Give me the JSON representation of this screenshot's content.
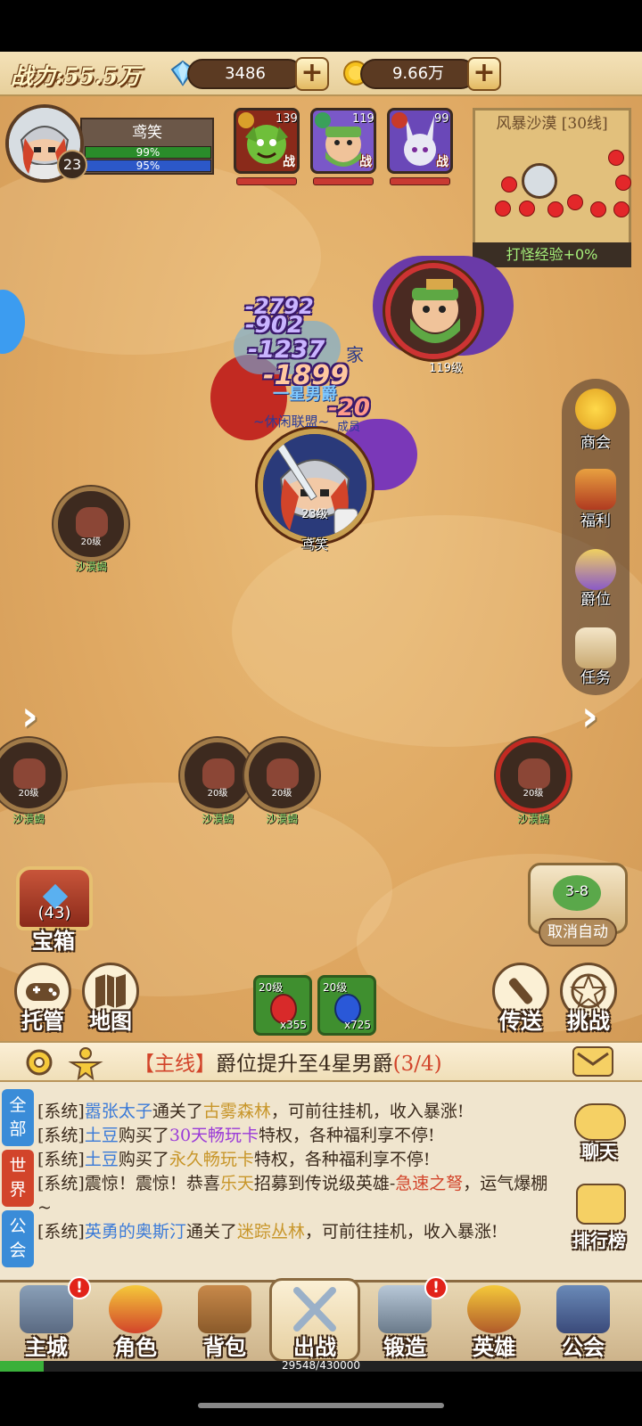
{
  "header": {
    "power_label": "战力:55.5万",
    "diamonds": "3486",
    "gold": "9.66万",
    "plus_symbol": "+"
  },
  "player": {
    "name": "鸢笑",
    "level": "23",
    "hp": "99%",
    "mp": "95%",
    "hp_fill": 0.99,
    "mp_fill": 0.95
  },
  "heroes": [
    {
      "level": "139",
      "tag": "战"
    },
    {
      "level": "119",
      "tag": "战"
    },
    {
      "level": "99",
      "tag": "战"
    }
  ],
  "minimap": {
    "title": "风暴沙漠 [30线]",
    "footer": "打怪经验+0%"
  },
  "battle": {
    "damage_numbers": [
      "-2792",
      "-902",
      "-1237",
      "-1899",
      "-20"
    ],
    "ally_level": "119级",
    "player_level": "23级",
    "player_name": "鸢笑",
    "title_text": "一星男爵",
    "guild_text": "~休闲联盟~",
    "partial_text_1": "家",
    "partial_text_2": "成员"
  },
  "monsters": {
    "level": "20级",
    "name": "沙漠蝎"
  },
  "right_menu": [
    "商会",
    "福利",
    "爵位",
    "任务"
  ],
  "treasure": {
    "count": "(43)",
    "label": "宝箱"
  },
  "auto_battle": {
    "stage": "3-8",
    "label": "取消自动"
  },
  "bottom_buttons": {
    "auto": "托管",
    "map": "地图",
    "teleport": "传送",
    "challenge": "挑战"
  },
  "potions": [
    {
      "level": "20级",
      "count": "x355"
    },
    {
      "level": "20级",
      "count": "x725"
    }
  ],
  "quest": {
    "tag": "【主线】",
    "text": "爵位提升至4星男爵",
    "progress": "(3/4)"
  },
  "chat": {
    "tabs": [
      "全部",
      "世界",
      "公会"
    ],
    "side_buttons": [
      "聊天",
      "排行榜"
    ],
    "lines": [
      {
        "prefix": "[系统]",
        "who": "嚣张太子",
        "mid": "通关了",
        "target": "古雾森林",
        "rest": "，可前往挂机，收入暴涨!"
      },
      {
        "prefix": "[系统]",
        "who": "土豆",
        "mid": "购买了",
        "target": "30天畅玩卡",
        "rest": "特权，各种福利享不停!"
      },
      {
        "prefix": "[系统]",
        "who": "土豆",
        "mid": "购买了",
        "target": "永久畅玩卡",
        "rest": "特权，各种福利享不停!"
      },
      {
        "prefix": "[系统]",
        "who": "震惊！震惊！恭喜",
        "mid": "乐天",
        "target": "招募到传说级英雄-",
        "rest": "急速之弩",
        "tail": "，运气爆棚~"
      },
      {
        "prefix": "[系统]",
        "who": "英勇的奥斯汀",
        "mid": "通关了",
        "target": "迷踪丛林",
        "rest": "，可前往挂机，收入暴涨!"
      }
    ]
  },
  "nav": {
    "items": [
      "主城",
      "角色",
      "背包",
      "出战",
      "锻造",
      "英雄",
      "公会"
    ],
    "badge": "!"
  },
  "xp": {
    "text": "29548/430000",
    "fill": 0.0687
  }
}
